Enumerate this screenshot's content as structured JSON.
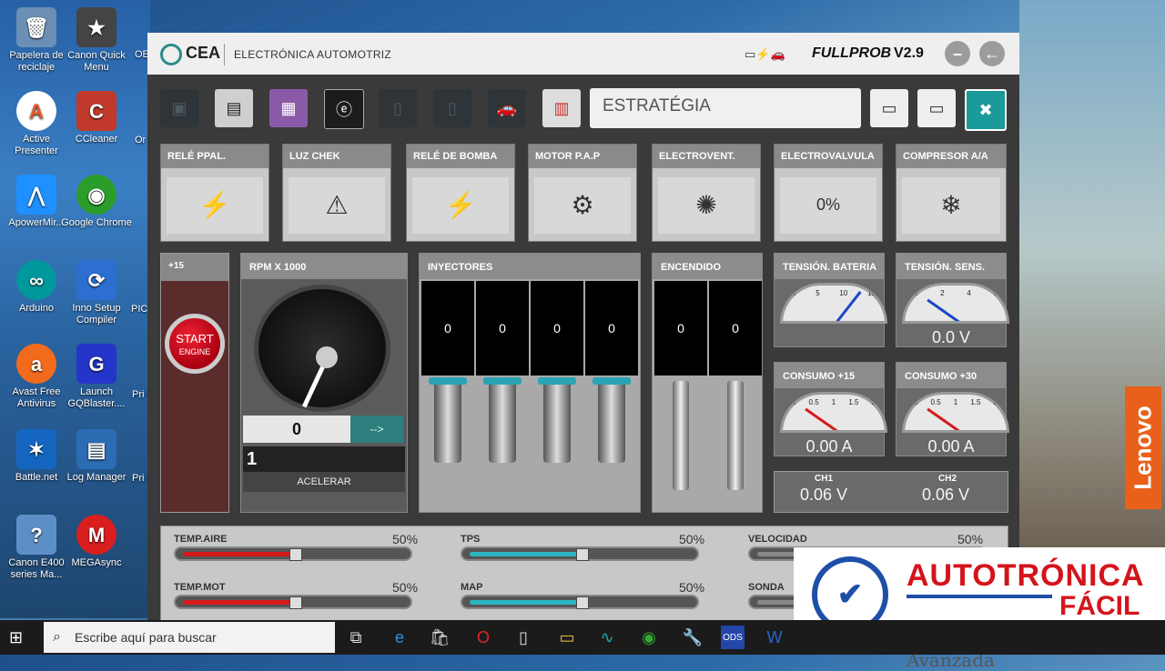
{
  "desktop": {
    "left_icons": [
      {
        "label": "Papelera de reciclaje",
        "glyph": "🗑",
        "color": "#6b8fb5"
      },
      {
        "label": "Canon Quick Menu",
        "glyph": "★",
        "color": "#444"
      },
      {
        "label": "Active Presenter",
        "glyph": "A",
        "color": "#e05a2a"
      },
      {
        "label": "CCleaner",
        "glyph": "C",
        "color": "#c0392b"
      },
      {
        "label": "ApowerMir...",
        "glyph": "⋀",
        "color": "#1e90ff"
      },
      {
        "label": "Google Chrome",
        "glyph": "◉",
        "color": "#2a9d2a"
      },
      {
        "label": "Arduino",
        "glyph": "∞",
        "color": "#00979d"
      },
      {
        "label": "Inno Setup Compiler",
        "glyph": "⟳",
        "color": "#2c6fd1"
      },
      {
        "label": "Avast Free Antivirus",
        "glyph": "a",
        "color": "#f26b1d"
      },
      {
        "label": "Launch GQBlaster....",
        "glyph": "G",
        "color": "#2435c9"
      },
      {
        "label": "Battle.net",
        "glyph": "✶",
        "color": "#1465c0"
      },
      {
        "label": "Log Manager",
        "glyph": "▤",
        "color": "#2b6cb3"
      },
      {
        "label": "Canon E400 series Ma...",
        "glyph": "?",
        "color": "#5d8fc7"
      },
      {
        "label": "MEGAsync",
        "glyph": "M",
        "color": "#d91e1e"
      }
    ],
    "edge_labels": [
      "OE",
      "Or Vi",
      "PIC",
      "Pri Pro",
      "Pri Pro"
    ],
    "brand_strip": "Lenovo"
  },
  "app": {
    "brand": "CEA",
    "subtitle": "ELECTRÓNICA AUTOMOTRIZ",
    "product": "FULLPROB",
    "version": "V2.9",
    "strategy_label": "ESTRATÉGIA",
    "toolbar_tools": [
      "scanner-tool",
      "ecu-tool",
      "ecu-color-tool",
      "e-tool",
      "ecu-tool-2",
      "ecu-tool-3",
      "car-tool",
      "strategy-tool"
    ],
    "actuators": [
      {
        "name": "RELÉ PPAL.",
        "icon": "relay-icon",
        "glyph": "⚡"
      },
      {
        "name": "LUZ CHEK",
        "icon": "engine-check-icon",
        "glyph": "⚠"
      },
      {
        "name": "RELÉ DE BOMBA",
        "icon": "relay-icon",
        "glyph": "⚡"
      },
      {
        "name": "MOTOR P.A.P",
        "icon": "idle-motor-icon",
        "glyph": "⚙"
      },
      {
        "name": "ELECTROVENT.",
        "icon": "fan-icon",
        "glyph": "✺"
      },
      {
        "name": "ELECTROVALVULA",
        "icon": "valve-icon",
        "glyph": "0%"
      },
      {
        "name": "COMPRESOR A/A",
        "icon": "compressor-icon",
        "glyph": "❄"
      }
    ],
    "start": {
      "header": "+15",
      "line1": "START",
      "line2": "ENGINE"
    },
    "rpm": {
      "header": "RPM X 1000",
      "value": "0",
      "go": "-->",
      "input": "1",
      "accel": "ACELERAR"
    },
    "injectors": {
      "header": "INYECTORES",
      "values": [
        "0",
        "0",
        "0",
        "0"
      ]
    },
    "ignition": {
      "header": "ENCENDIDO",
      "values": [
        "0",
        "0"
      ]
    },
    "meters": [
      {
        "title": "TENSIÓN. BATERIA",
        "scale": [
          "0",
          "5",
          "10",
          "15"
        ],
        "reading": ""
      },
      {
        "title": "TENSIÓN. SENS.",
        "scale": [
          "0",
          "2",
          "4",
          "6"
        ],
        "reading": "0.0 V"
      },
      {
        "title": "CONSUMO +15",
        "scale": [
          "0",
          "0.5",
          "1",
          "1.5",
          "2"
        ],
        "reading": "0.00 A"
      },
      {
        "title": "CONSUMO +30",
        "scale": [
          "0",
          "0.5",
          "1",
          "1.5",
          "2"
        ],
        "reading": "0.00 A"
      }
    ],
    "channels": [
      {
        "label": "CH1",
        "value": "0.06 V"
      },
      {
        "label": "CH2",
        "value": "0.06 V"
      }
    ],
    "sliders": [
      {
        "label": "TEMP.AIRE",
        "pct": "50%",
        "level": 0.5,
        "color": "#d61a1a"
      },
      {
        "label": "TPS",
        "pct": "50%",
        "level": 0.5,
        "color": "#2bb5c2"
      },
      {
        "label": "VELOCIDAD",
        "pct": "50%",
        "level": 0.5,
        "color": "#888888"
      },
      {
        "label": "TEMP.MOT",
        "pct": "50%",
        "level": 0.5,
        "color": "#d61a1a"
      },
      {
        "label": "MAP",
        "pct": "50%",
        "level": 0.5,
        "color": "#2bb5c2"
      },
      {
        "label": "SONDA",
        "pct": "",
        "level": 0.5,
        "color": "#888888"
      }
    ]
  },
  "promo": {
    "title": "AUTOTRÓNICA",
    "subtitle": "FÁCIL",
    "tagline": "Ingeniería Automotriz Avanzada"
  },
  "taskbar": {
    "search_placeholder": "Escribe aquí para buscar"
  }
}
